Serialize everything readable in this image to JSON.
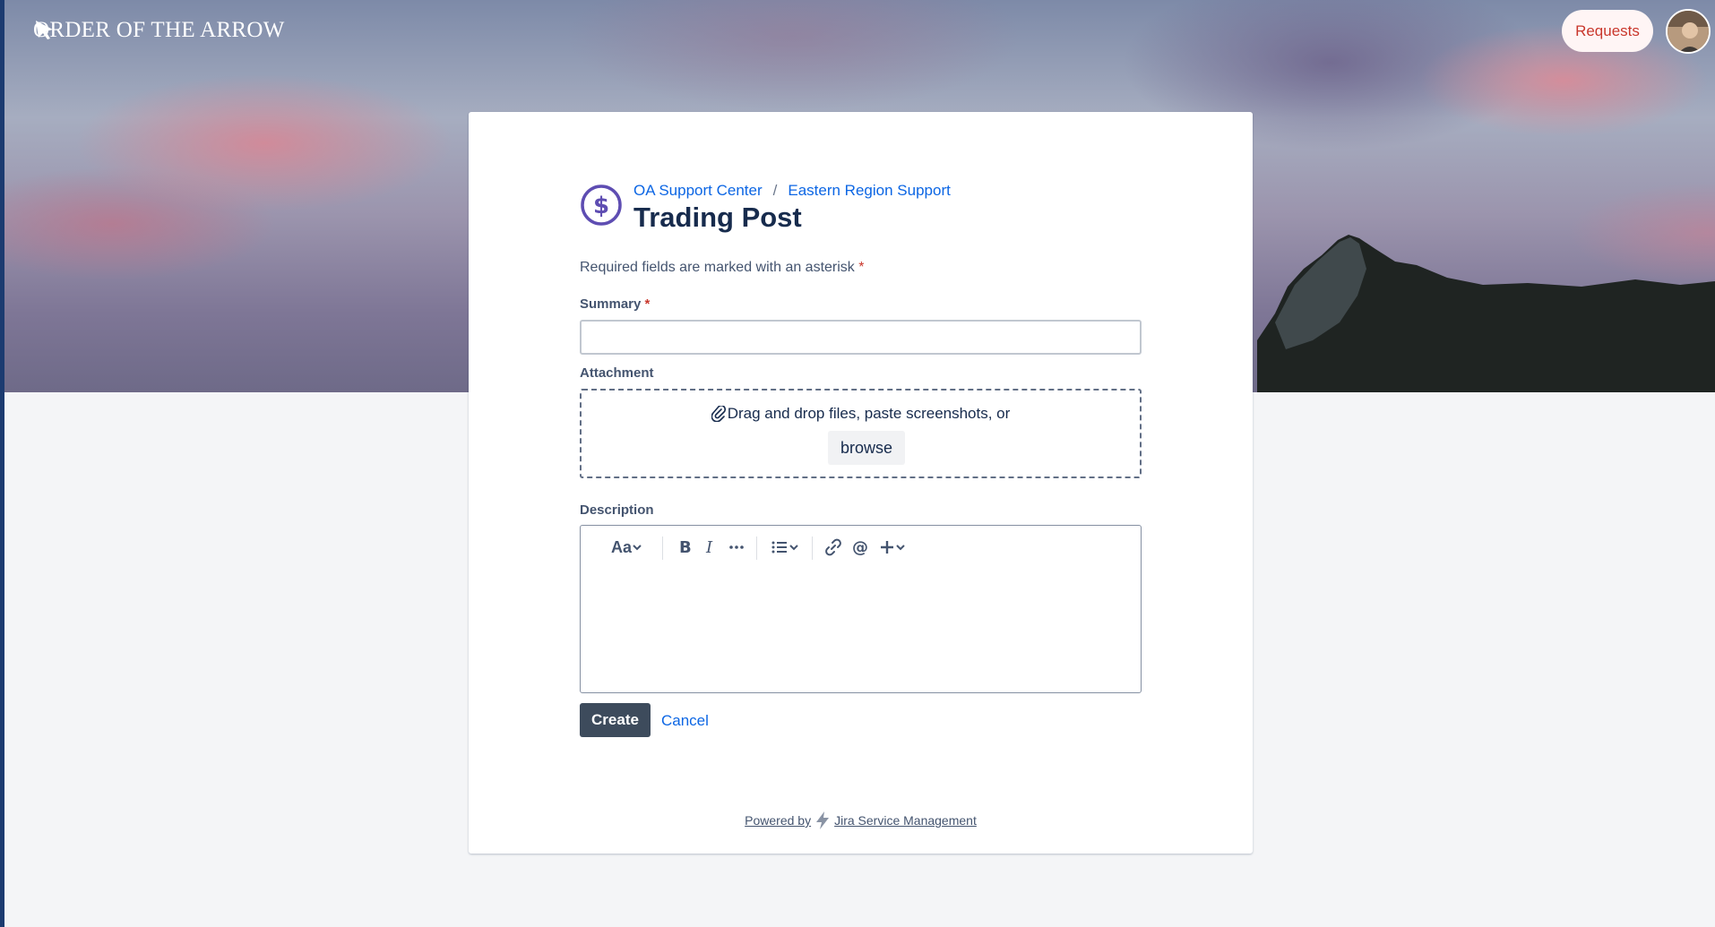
{
  "header": {
    "brand": "ORDER OF THE ARROW",
    "requests_label": "Requests"
  },
  "breadcrumb": {
    "items": [
      "OA Support Center",
      "Eastern Region Support"
    ],
    "separator": "/"
  },
  "page": {
    "title": "Trading Post",
    "icon": "dollar-circle-icon",
    "required_note": "Required fields are marked with an asterisk",
    "asterisk": "*"
  },
  "form": {
    "summary_label": "Summary",
    "summary_value": "",
    "attachment_label": "Attachment",
    "drop_text": "Drag and drop files, paste screenshots, or",
    "browse_label": "browse",
    "description_label": "Description",
    "toolbar": {
      "text_style": "Aa"
    },
    "create_label": "Create",
    "cancel_label": "Cancel"
  },
  "footer": {
    "powered_by": "Powered by",
    "product": "Jira Service Management"
  },
  "colors": {
    "link": "#0c66e4",
    "primary_button": "#3d4b5c",
    "required": "#c9372c",
    "icon_purple": "#5e4db2",
    "requests_text": "#c9372c"
  }
}
